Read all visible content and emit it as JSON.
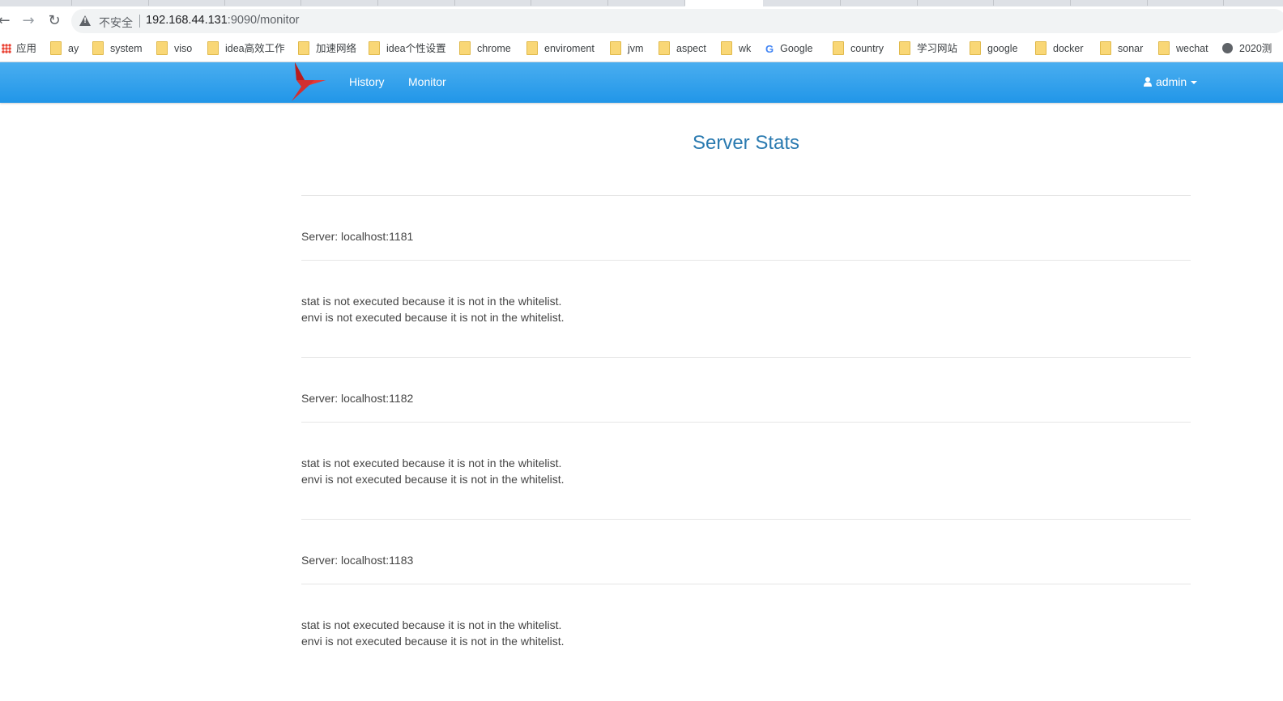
{
  "browser": {
    "insecure_label": "不安全",
    "url_host": "192.168.44.131",
    "url_rest": ":9090/monitor"
  },
  "bookmarks": [
    {
      "label": "应用",
      "icon": "apps-icon"
    },
    {
      "label": "ay",
      "icon": "folder-icon"
    },
    {
      "label": "system",
      "icon": "folder-icon"
    },
    {
      "label": "viso",
      "icon": "folder-icon"
    },
    {
      "label": "idea高效工作",
      "icon": "folder-icon"
    },
    {
      "label": "加速网络",
      "icon": "folder-icon"
    },
    {
      "label": "idea个性设置",
      "icon": "folder-icon"
    },
    {
      "label": "chrome",
      "icon": "folder-icon"
    },
    {
      "label": "enviroment",
      "icon": "folder-icon"
    },
    {
      "label": "jvm",
      "icon": "folder-icon"
    },
    {
      "label": "aspect",
      "icon": "folder-icon"
    },
    {
      "label": "wk",
      "icon": "folder-icon"
    },
    {
      "label": "Google",
      "icon": "google-icon"
    },
    {
      "label": "country",
      "icon": "folder-icon"
    },
    {
      "label": "学习网站",
      "icon": "folder-icon"
    },
    {
      "label": "google",
      "icon": "folder-icon"
    },
    {
      "label": "docker",
      "icon": "folder-icon"
    },
    {
      "label": "sonar",
      "icon": "folder-icon"
    },
    {
      "label": "wechat",
      "icon": "folder-icon"
    },
    {
      "label": "2020测",
      "icon": "globe-icon"
    }
  ],
  "navbar": {
    "history": "History",
    "monitor": "Monitor",
    "user": "admin",
    "brand_color": "#2196e8"
  },
  "page": {
    "title": "Server Stats",
    "servers": [
      {
        "label": "Server: localhost:1181",
        "stat_msg": "stat is not executed because it is not in the whitelist.",
        "envi_msg": "envi is not executed because it is not in the whitelist."
      },
      {
        "label": "Server: localhost:1182",
        "stat_msg": "stat is not executed because it is not in the whitelist.",
        "envi_msg": "envi is not executed because it is not in the whitelist."
      },
      {
        "label": "Server: localhost:1183",
        "stat_msg": "stat is not executed because it is not in the whitelist.",
        "envi_msg": "envi is not executed because it is not in the whitelist."
      }
    ]
  }
}
